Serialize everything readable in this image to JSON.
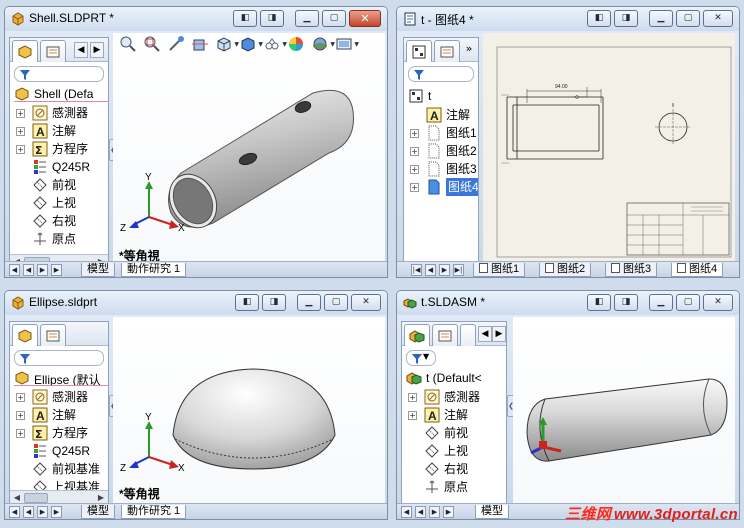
{
  "windows": {
    "shell": {
      "title": "Shell.SLDPRT *",
      "view_label": "*等角視",
      "tree_root": "Shell  (Defa",
      "tree_items": [
        {
          "label": "感測器",
          "icon": "sensor-icon"
        },
        {
          "label": "注解",
          "icon": "annotation-icon"
        },
        {
          "label": "方程序",
          "icon": "equation-icon"
        },
        {
          "label": "Q245R",
          "icon": "material-icon"
        },
        {
          "label": "前视",
          "icon": "plane-icon"
        },
        {
          "label": "上视",
          "icon": "plane-icon"
        },
        {
          "label": "右视",
          "icon": "plane-icon"
        },
        {
          "label": "原点",
          "icon": "origin-icon"
        }
      ],
      "bottom_tabs": [
        "模型",
        "動作研究 1"
      ]
    },
    "drawing": {
      "title": "t - 图纸4 *",
      "tree_root": "t",
      "tree_items": [
        {
          "label": "注解",
          "icon": "annotation-icon"
        },
        {
          "label": "图纸1",
          "icon": "sheet-icon"
        },
        {
          "label": "图纸2",
          "icon": "sheet-icon"
        },
        {
          "label": "图纸3",
          "icon": "sheet-icon"
        },
        {
          "label": "图纸4",
          "icon": "sheet-icon",
          "selected": true
        }
      ],
      "sheet_tabs": [
        "图纸1",
        "图纸2",
        "图纸3",
        "图纸4"
      ],
      "dimension_text": "94.00"
    },
    "ellipse": {
      "title": "Ellipse.sldprt",
      "view_label": "*等角視",
      "tree_root": "Ellipse  (默认",
      "tree_items": [
        {
          "label": "感測器",
          "icon": "sensor-icon"
        },
        {
          "label": "注解",
          "icon": "annotation-icon"
        },
        {
          "label": "方程序",
          "icon": "equation-icon"
        },
        {
          "label": "Q245R",
          "icon": "material-icon"
        },
        {
          "label": "前视基准",
          "icon": "plane-icon"
        },
        {
          "label": "上视基准",
          "icon": "plane-icon"
        }
      ],
      "bottom_tabs": [
        "模型",
        "動作研究 1"
      ]
    },
    "assembly": {
      "title": "t.SLDASM *",
      "tree_root": "t  (Default<",
      "tree_items": [
        {
          "label": "感測器",
          "icon": "sensor-icon"
        },
        {
          "label": "注解",
          "icon": "annotation-icon"
        },
        {
          "label": "前视",
          "icon": "plane-icon"
        },
        {
          "label": "上视",
          "icon": "plane-icon"
        },
        {
          "label": "右视",
          "icon": "plane-icon"
        },
        {
          "label": "原点",
          "icon": "origin-icon"
        }
      ],
      "bottom_tabs": [
        "模型"
      ]
    }
  },
  "axis_labels": {
    "x": "X",
    "y": "Y",
    "z": "Z"
  },
  "watermark": {
    "cn": "三维网",
    "url": "www.3dportal.cn"
  },
  "colors": {
    "selection": "#3a77d8",
    "close_button": "#c4452b",
    "watermark": "#e0201a"
  }
}
